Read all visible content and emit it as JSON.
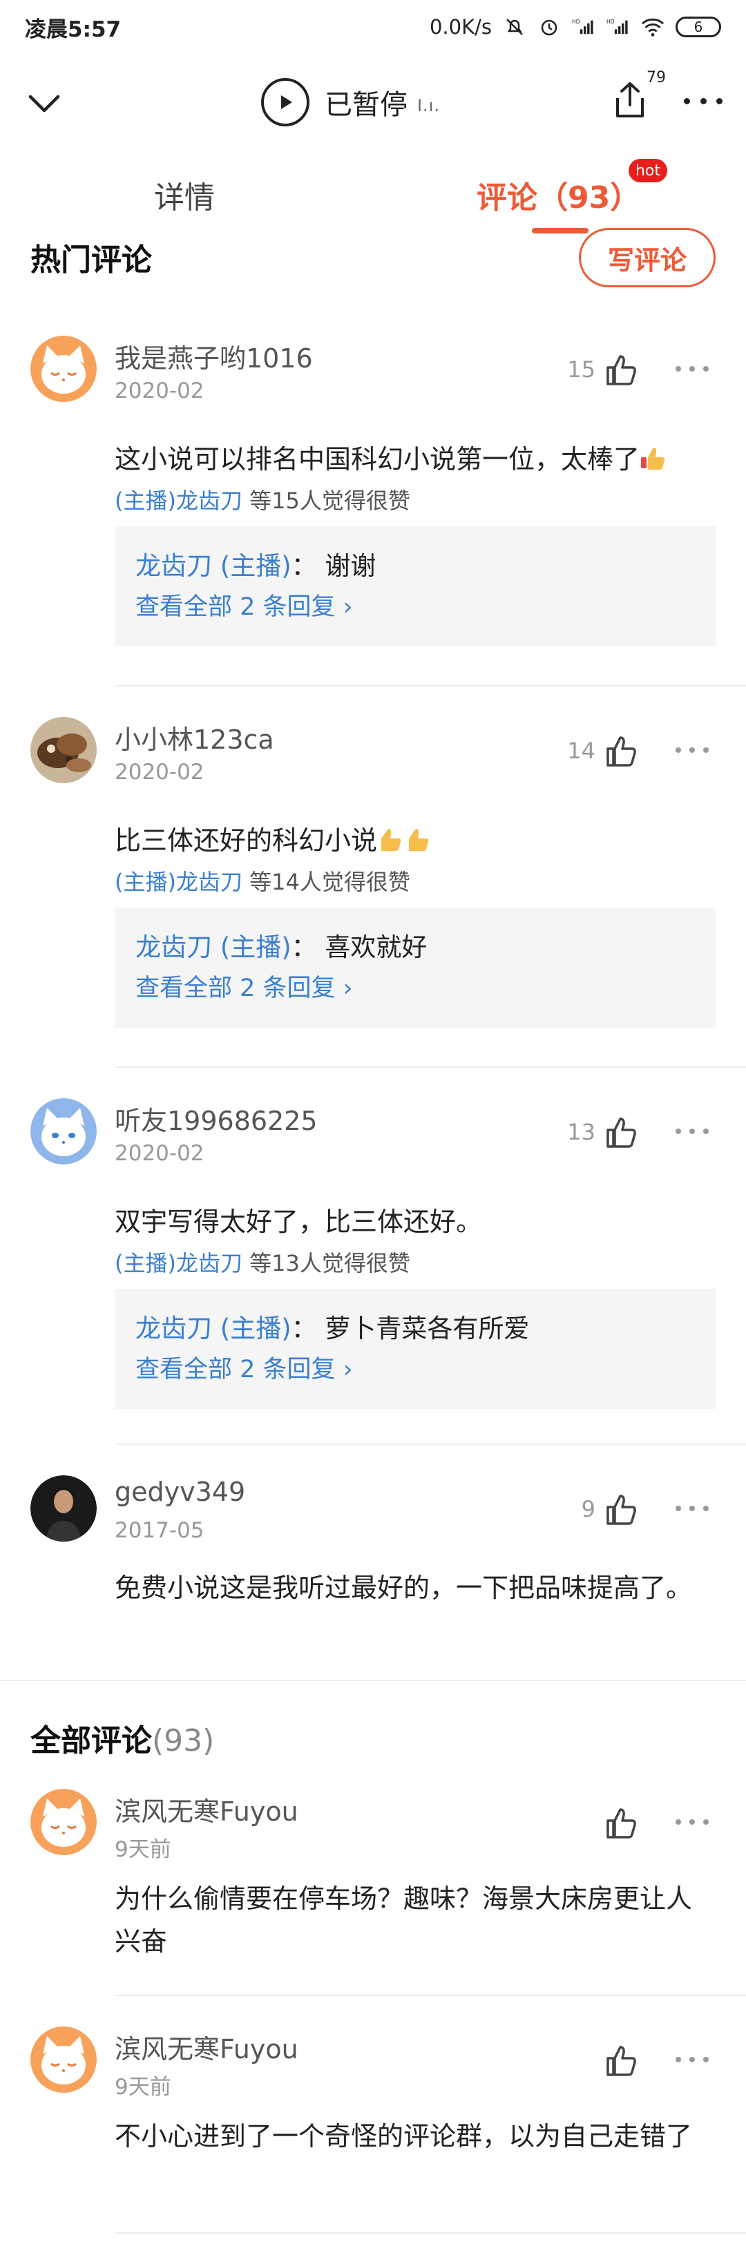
{
  "status_bar": {
    "time": "凌晨5:57",
    "network_speed": "0.0K/s",
    "battery": "6"
  },
  "player": {
    "status": "已暂停",
    "bars": "I.ı."
  },
  "share": {
    "count": "79"
  },
  "tabs": {
    "detail": "详情",
    "comments": "评论（93）",
    "hot_badge": "hot"
  },
  "hot_section": {
    "title": "热门评论",
    "write_button": "写评论"
  },
  "hot_comments": [
    {
      "username": "我是燕子哟1016",
      "date": "2020-02",
      "likes": "15",
      "text": "这小说可以排名中国科幻小说第一位，太棒了",
      "liked_by_name": "(主播)龙齿刀",
      "liked_by_suffix": " 等15人觉得很赞",
      "reply_author": "龙齿刀 (主播)",
      "reply_text": "：  谢谢",
      "reply_more": "查看全部 2 条回复 ›"
    },
    {
      "username": "小小林123ca",
      "date": "2020-02",
      "likes": "14",
      "text": "比三体还好的科幻小说",
      "liked_by_name": "(主播)龙齿刀",
      "liked_by_suffix": " 等14人觉得很赞",
      "reply_author": "龙齿刀 (主播)",
      "reply_text": "：  喜欢就好",
      "reply_more": "查看全部 2 条回复 ›"
    },
    {
      "username": "听友199686225",
      "date": "2020-02",
      "likes": "13",
      "text": "双宇写得太好了，比三体还好。",
      "liked_by_name": "(主播)龙齿刀",
      "liked_by_suffix": " 等13人觉得很赞",
      "reply_author": "龙齿刀 (主播)",
      "reply_text": "：  萝卜青菜各有所爱",
      "reply_more": "查看全部 2 条回复 ›"
    },
    {
      "username": "gedyv349",
      "date": "2017-05",
      "likes": "9",
      "text": "免费小说这是我听过最好的，一下把品味提高了。"
    }
  ],
  "all_section": {
    "title": "全部评论",
    "count": "(93)"
  },
  "all_comments": [
    {
      "username": "滨风无寒Fuyou",
      "date": "9天前",
      "text": "为什么偷情要在停车场？趣味？海景大床房更让人兴奋"
    },
    {
      "username": "滨风无寒Fuyou",
      "date": "9天前",
      "text": "不小心进到了一个奇怪的评论群，以为自己走错了"
    }
  ]
}
